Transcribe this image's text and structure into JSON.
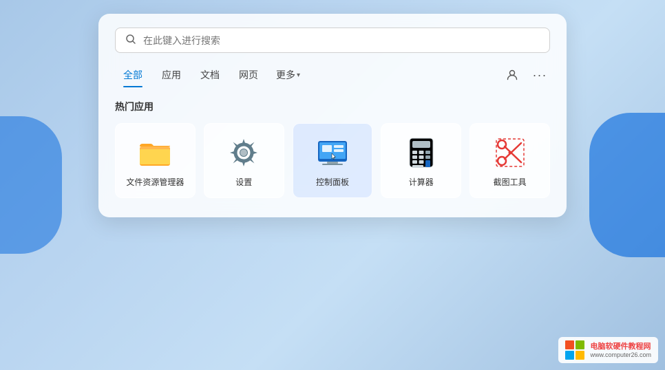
{
  "background": {
    "gradient_start": "#a8c8e8",
    "gradient_end": "#a0c0e0"
  },
  "search_panel": {
    "search_bar": {
      "placeholder": "在此键入进行搜索",
      "icon": "search-icon"
    },
    "tabs": [
      {
        "id": "all",
        "label": "全部",
        "active": true
      },
      {
        "id": "apps",
        "label": "应用",
        "active": false
      },
      {
        "id": "docs",
        "label": "文档",
        "active": false
      },
      {
        "id": "web",
        "label": "网页",
        "active": false
      },
      {
        "id": "more",
        "label": "更多",
        "active": false,
        "has_chevron": true
      }
    ],
    "section_title": "热门应用",
    "apps": [
      {
        "id": "file-explorer",
        "label": "文件资源管理器",
        "icon": "folder"
      },
      {
        "id": "settings",
        "label": "设置",
        "icon": "gear"
      },
      {
        "id": "control-panel",
        "label": "控制面板",
        "icon": "control-panel",
        "highlighted": true
      },
      {
        "id": "calculator",
        "label": "计算器",
        "icon": "calculator"
      },
      {
        "id": "snipping-tool",
        "label": "截图工具",
        "icon": "scissors"
      }
    ]
  },
  "watermark": {
    "title": "电脑软硬件教程网",
    "url": "www.computer26.com"
  },
  "icons": {
    "search": "🔍",
    "person": "👤",
    "more": "•••"
  }
}
